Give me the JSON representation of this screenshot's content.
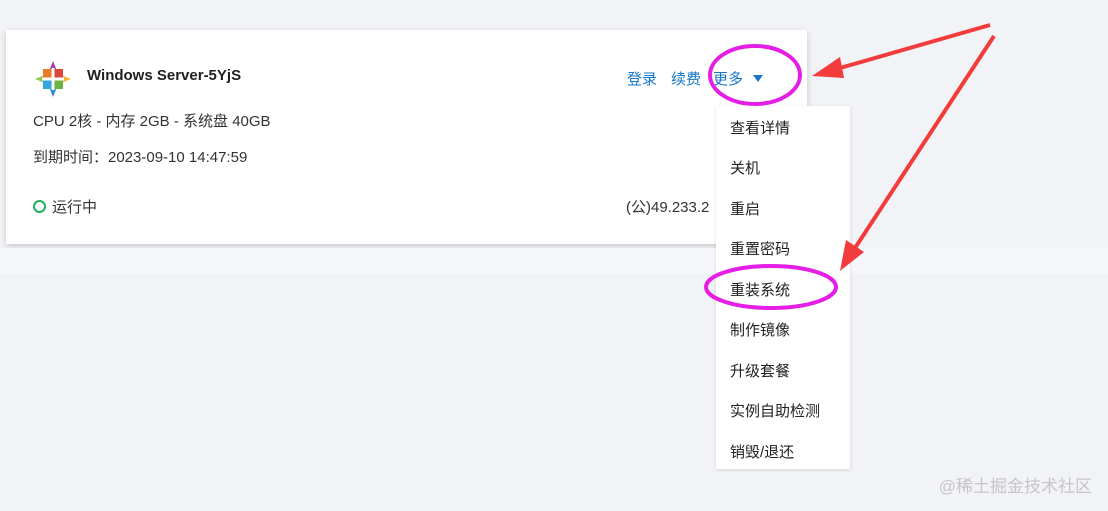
{
  "server": {
    "name": "Windows Server-5YjS",
    "logo_icon": "windows-server-logo-icon",
    "spec": "CPU 2核 - 内存 2GB - 系统盘 40GB",
    "expire": "到期时间：2023-09-10 14:47:59",
    "status": "运行中",
    "status_color": "#1fb25a",
    "ip": "(公)49.233.2"
  },
  "actions": {
    "login": "登录",
    "renew": "续费",
    "more": "更多"
  },
  "menu": {
    "items": [
      "查看详情",
      "关机",
      "重启",
      "重置密码",
      "重装系统",
      "制作镜像",
      "升级套餐",
      "实例自助检测",
      "销毁/退还"
    ]
  },
  "annotation_colors": {
    "highlight": "#e41ee4",
    "arrow": "#f23b3b"
  },
  "watermark": "@稀土掘金技术社区"
}
